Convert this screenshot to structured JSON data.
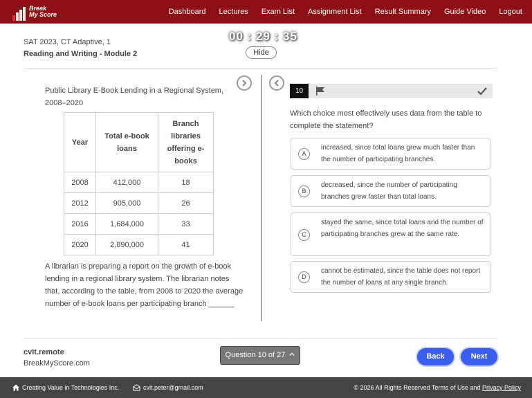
{
  "brand": {
    "line1": "Break",
    "line2": "My Score"
  },
  "nav": {
    "items": [
      "Dashboard",
      "Lectures",
      "Exam List",
      "Assignment List",
      "Result Summary",
      "Guide Video",
      "Logout"
    ]
  },
  "header": {
    "exam_name": "SAT 2023, CT Adaptive, 1",
    "module_name": "Reading and Writing - Module 2",
    "timer": "00 : 29 : 35",
    "hide_label": "Hide"
  },
  "passage": {
    "table_title": "Public Library E-Book Lending in a Regional System, 2008–2020",
    "columns": [
      "Year",
      "Total e-book loans",
      "Branch libraries offering e-books"
    ],
    "rows": [
      [
        "2008",
        "412,000",
        "18"
      ],
      [
        "2012",
        "905,000",
        "26"
      ],
      [
        "2016",
        "1,684,000",
        "33"
      ],
      [
        "2020",
        "2,890,000",
        "41"
      ]
    ],
    "text": "A librarian is preparing a report on the growth of e-book lending in a regional library system. The librarian notes that, according to the table, from 2008 to 2020 the average number of e-book loans per participating branch ______"
  },
  "question": {
    "number": "10",
    "prompt": "Which choice most effectively uses data from the table to complete the statement?",
    "options": [
      {
        "letter": "A",
        "text": "increased, since total loans grew much faster than the number of participating branches."
      },
      {
        "letter": "B",
        "text": "decreased, since the number of participating branches grew faster than total loans."
      },
      {
        "letter": "C",
        "text": "stayed the same, since total loans and the number of participating branches grew at the same rate."
      },
      {
        "letter": "D",
        "text": "cannot be estimated, since the table does not report the number of loans at any single branch."
      }
    ]
  },
  "footer": {
    "user": "cvit.remote",
    "site": "BreakMyScore.com",
    "question_nav": "Question 10 of 27",
    "back": "Back",
    "next": "Next"
  },
  "bottombar": {
    "company": "Creating Value in Technologies Inc.",
    "email": "cvit.peter@gmail.com",
    "rights": "© 2026 All Rights Reserved Terms of Use and",
    "privacy": "Privacy Policy"
  },
  "colors": {
    "nav_bg": "#8b0f14",
    "button_blue": "#3b5ef0",
    "footer_bg": "#444444"
  }
}
